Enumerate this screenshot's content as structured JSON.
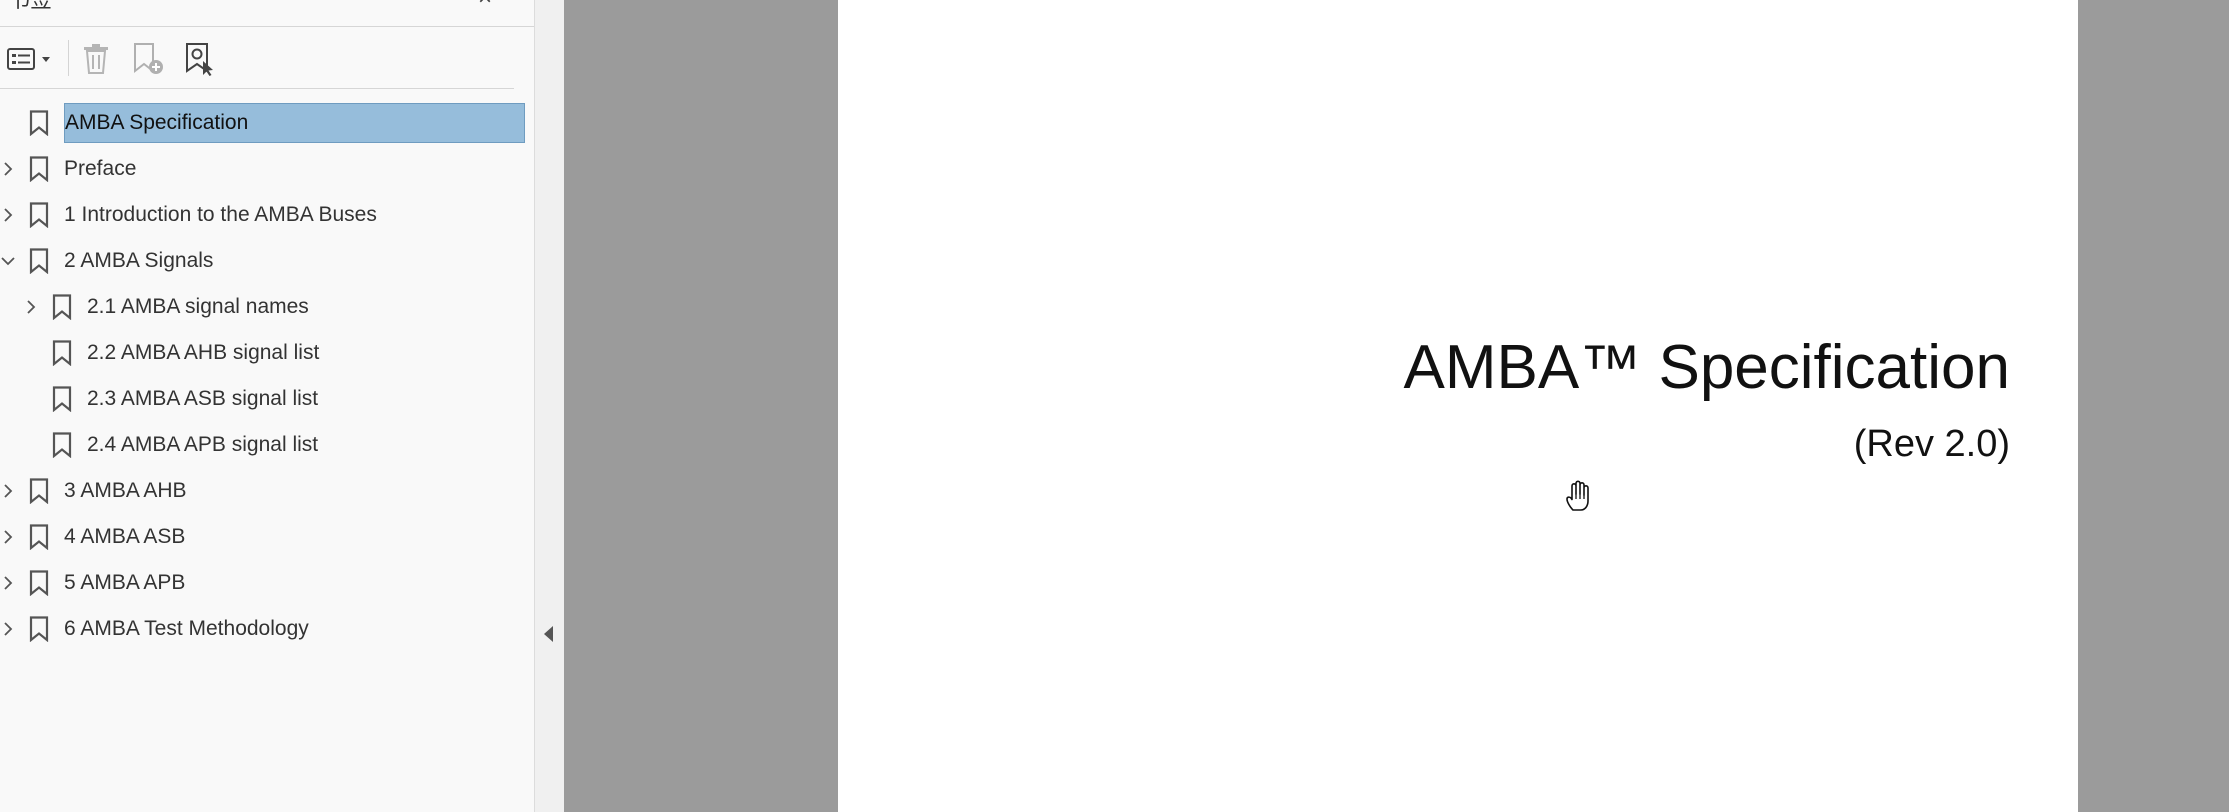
{
  "sidebar": {
    "panel_title": "书签",
    "close_glyph": "×",
    "toolbar": {
      "options_icon": "list-options-icon",
      "delete_icon": "trash-icon",
      "add_icon": "add-bookmark-icon",
      "find_icon": "find-current-bookmark-icon"
    },
    "items": [
      {
        "label": "AMBA Specification",
        "expandable": false,
        "expanded": false,
        "level": 0,
        "selected": true
      },
      {
        "label": "Preface",
        "expandable": true,
        "expanded": false,
        "level": 0,
        "selected": false
      },
      {
        "label": "1 Introduction to the AMBA Buses",
        "expandable": true,
        "expanded": false,
        "level": 0,
        "selected": false
      },
      {
        "label": "2 AMBA Signals",
        "expandable": true,
        "expanded": true,
        "level": 0,
        "selected": false
      },
      {
        "label": "2.1 AMBA signal names",
        "expandable": true,
        "expanded": false,
        "level": 1,
        "selected": false
      },
      {
        "label": "2.2 AMBA AHB signal list",
        "expandable": false,
        "expanded": false,
        "level": 1,
        "selected": false
      },
      {
        "label": "2.3 AMBA ASB signal list",
        "expandable": false,
        "expanded": false,
        "level": 1,
        "selected": false
      },
      {
        "label": "2.4 AMBA APB signal list",
        "expandable": false,
        "expanded": false,
        "level": 1,
        "selected": false
      },
      {
        "label": "3 AMBA AHB",
        "expandable": true,
        "expanded": false,
        "level": 0,
        "selected": false
      },
      {
        "label": "4 AMBA ASB",
        "expandable": true,
        "expanded": false,
        "level": 0,
        "selected": false
      },
      {
        "label": "5 AMBA APB",
        "expandable": true,
        "expanded": false,
        "level": 0,
        "selected": false
      },
      {
        "label": "6 AMBA Test Methodology",
        "expandable": true,
        "expanded": false,
        "level": 0,
        "selected": false
      }
    ]
  },
  "document": {
    "title": "AMBA™ Specification",
    "subtitle": "(Rev 2.0)",
    "cursor_icon": "hand-cursor-icon"
  },
  "colors": {
    "selection": "#96bddb",
    "doc_background": "#9b9b9b",
    "page": "#ffffff"
  }
}
